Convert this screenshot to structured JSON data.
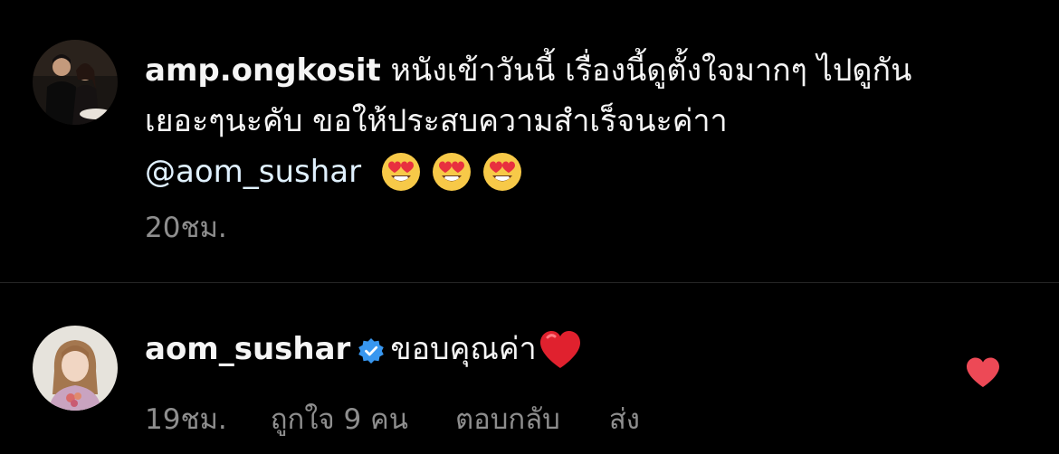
{
  "comments": [
    {
      "username": "amp.ongkosit",
      "text_line1": " หนังเข้าวันนี้ เรื่องนี้ดูตั้งใจมากๆ ไปดูกัน",
      "text_line2": "เยอะๆนะคับ ขอให้ประสบความสำเร็จนะค่าา",
      "mention": "@aom_sushar",
      "emojis": [
        "heart-eyes-emoji",
        "heart-eyes-emoji",
        "heart-eyes-emoji"
      ],
      "time": "20ชม."
    },
    {
      "username": "aom_sushar",
      "verified": true,
      "text": "ขอบคุณค่า",
      "emoji": "red-heart-emoji",
      "time": "19ชม.",
      "likes": "ถูกใจ 9 คน",
      "reply": "ตอบกลับ",
      "send": "ส่ง",
      "liked": true
    }
  ],
  "colors": {
    "background": "#000000",
    "text": "#f5f5f5",
    "meta": "#8e8e8e",
    "mention": "#e0f1ff",
    "verified_badge": "#3897f0",
    "like_heart": "#ed4956",
    "divider": "#262626"
  }
}
